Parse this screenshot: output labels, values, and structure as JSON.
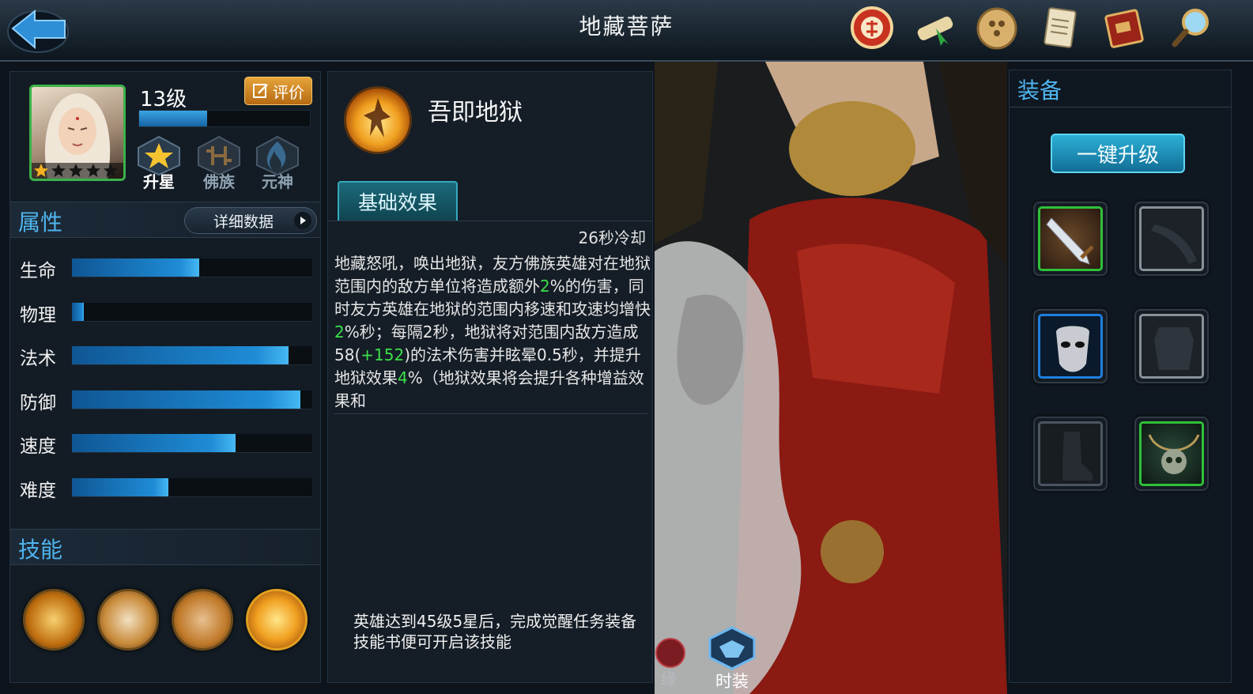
{
  "header": {
    "title": "地藏菩萨",
    "icons": [
      "trial-icon",
      "scroll-icon",
      "coin-icon",
      "document-icon",
      "book-icon",
      "magnifier-icon"
    ]
  },
  "hero": {
    "level": "13级",
    "rate_label": "评价",
    "xp_fraction": 0.4,
    "stars_filled": 1,
    "stars_total": 5,
    "badges": [
      "升星",
      "佛族",
      "元神"
    ]
  },
  "attributes": {
    "title": "属性",
    "detail_label": "详细数据",
    "stats": [
      {
        "label": "生命",
        "value": 0.53
      },
      {
        "label": "物理",
        "value": 0.05
      },
      {
        "label": "法术",
        "value": 0.9
      },
      {
        "label": "防御",
        "value": 0.95
      },
      {
        "label": "速度",
        "value": 0.68
      },
      {
        "label": "难度",
        "value": 0.4
      }
    ]
  },
  "skills": {
    "title": "技能",
    "icons": [
      "hand-orb-skill-icon",
      "palm-strike-skill-icon",
      "prayer-hand-skill-icon",
      "hell-flame-skill-icon"
    ]
  },
  "skill_detail": {
    "name": "吾即地狱",
    "tab_label": "基础效果",
    "cooldown": "26秒冷却",
    "desc_parts": [
      {
        "t": "地藏怒吼，唤出地狱，友方佛族英雄对在地狱范围内的敌方单位将造成额外",
        "g": false
      },
      {
        "t": "2",
        "g": true
      },
      {
        "t": "%的伤害，同时友方英雄在地狱的范围内移速和攻速均增快",
        "g": false
      },
      {
        "t": "2",
        "g": true
      },
      {
        "t": "%秒；每隔2秒，地狱将对范围内敌方造成58(",
        "g": false
      },
      {
        "t": "+152",
        "g": true
      },
      {
        "t": ")的法术伤害并眩晕0.5秒，并提升地狱效果",
        "g": false
      },
      {
        "t": "4",
        "g": true
      },
      {
        "t": "%（地狱效果将会提升各种增益效果和",
        "g": false
      }
    ],
    "awaken_note": "英雄达到45级5星后，完成觉醒任务装备技能书便可开启该技能"
  },
  "bottom_tabs": {
    "fate": "缘",
    "costume": "时装"
  },
  "equipment": {
    "title": "装备",
    "one_key_label": "一键升级",
    "slots": [
      {
        "name": "sword-equip-slot",
        "state": "equipped",
        "rarity_color": "#2fc03a"
      },
      {
        "name": "blade-equip-slot",
        "state": "empty",
        "rarity_color": "#8a9299"
      },
      {
        "name": "mask-equip-slot",
        "state": "equipped",
        "rarity_color": "#1e7fe0"
      },
      {
        "name": "armor-equip-slot",
        "state": "empty",
        "rarity_color": "#8a9299"
      },
      {
        "name": "boots-equip-slot",
        "state": "empty",
        "rarity_color": "#4a5560"
      },
      {
        "name": "skull-necklace-equip-slot",
        "state": "equipped",
        "rarity_color": "#2fc03a"
      }
    ]
  }
}
